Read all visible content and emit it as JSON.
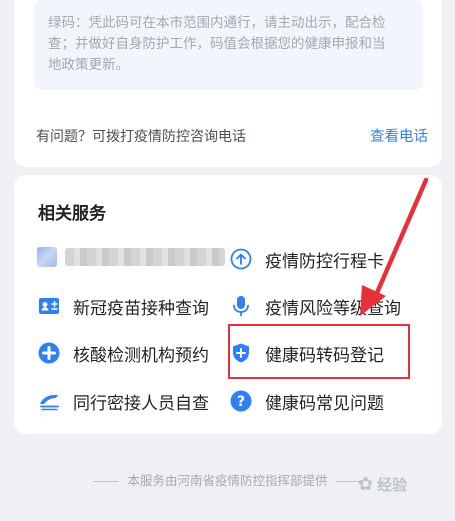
{
  "notice": {
    "line1": "绿码：凭此码可在本市范围内通行，请主动出示，配合检",
    "line2": "查；并做好自身防护工作，码值会根据您的健康申报和当",
    "line3": "地政策更新。"
  },
  "help": {
    "text": "有问题？可拨打疫情防控咨询电话",
    "link": "查看电话"
  },
  "services": {
    "title": "相关服务",
    "items": [
      {
        "label": "疫情防控行程卡"
      },
      {
        "label": "新冠疫苗接种查询"
      },
      {
        "label": "疫情风险等级查询"
      },
      {
        "label": "核酸检测机构预约"
      },
      {
        "label": "健康码转码登记"
      },
      {
        "label": "同行密接人员自查"
      },
      {
        "label": "健康码常见问题"
      }
    ]
  },
  "footer": {
    "text": "本服务由河南省疫情防控指挥部提供"
  },
  "watermark": {
    "text": "经验"
  },
  "colors": {
    "accent": "#2f7ff5",
    "highlight": "#e8303a"
  }
}
